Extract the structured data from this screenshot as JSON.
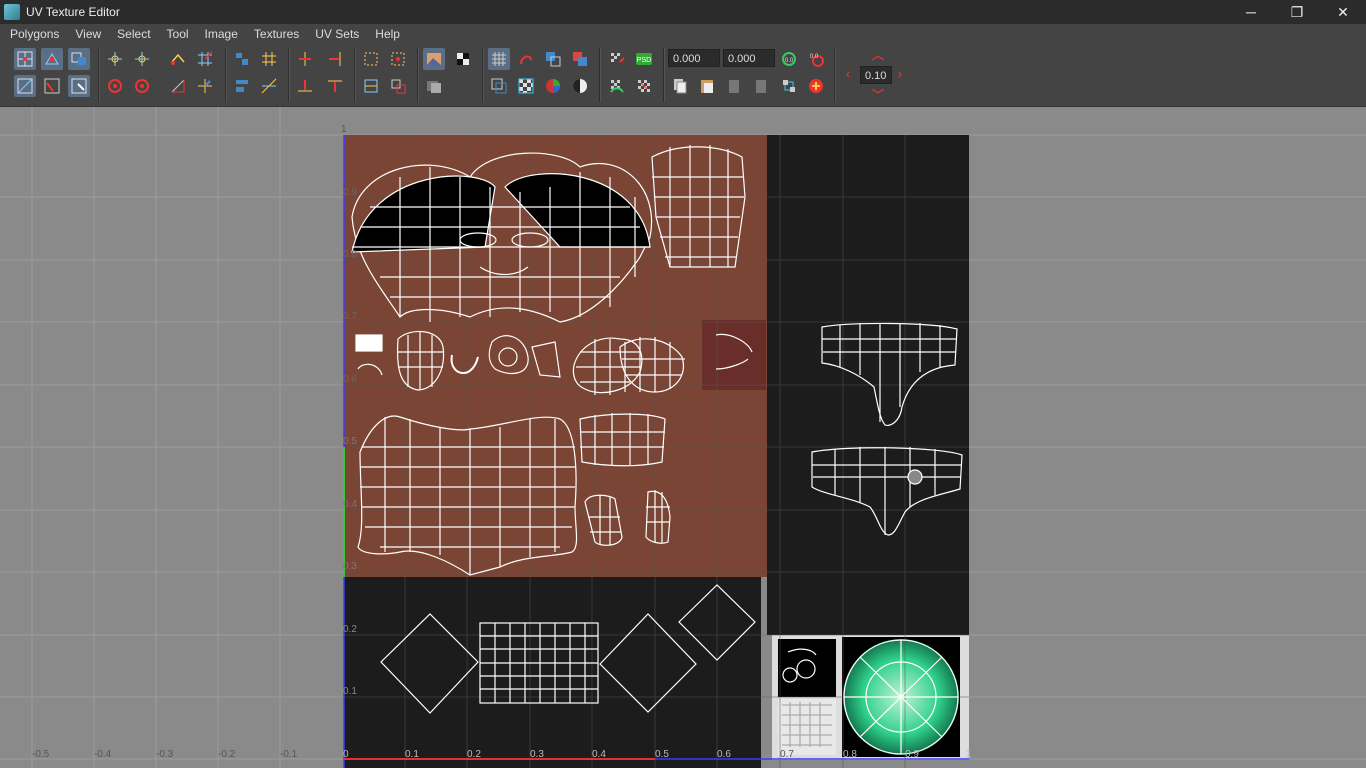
{
  "window": {
    "title": "UV Texture Editor"
  },
  "window_controls": {
    "minimize": "─",
    "restore": "❐",
    "close": "✕"
  },
  "menu": [
    "Polygons",
    "View",
    "Select",
    "Tool",
    "Image",
    "Textures",
    "UV Sets",
    "Help"
  ],
  "toolbar": {
    "u_value": "0.000",
    "v_value": "0.000",
    "step_value": "0.10"
  },
  "uv_grid": {
    "origin_label": "1",
    "u_ticks": [
      "-0.5",
      "-0.4",
      "-0.3",
      "-0.2",
      "-0.1",
      "0",
      "0.1",
      "0.2",
      "0.3",
      "0.4",
      "0.5",
      "0.6",
      "0.7",
      "0.8",
      "0.9",
      "1"
    ],
    "v_ticks": [
      "0.9",
      "0.8",
      "0.7",
      "0.6",
      "0.5",
      "0.4",
      "0.3",
      "0.2",
      "0.1"
    ]
  },
  "colors": {
    "texture_skin": "#7a4535",
    "texture_dark": "#1c1c1c",
    "grid_bg": "#8a8a8a",
    "accent_green": "#2fd08a"
  }
}
